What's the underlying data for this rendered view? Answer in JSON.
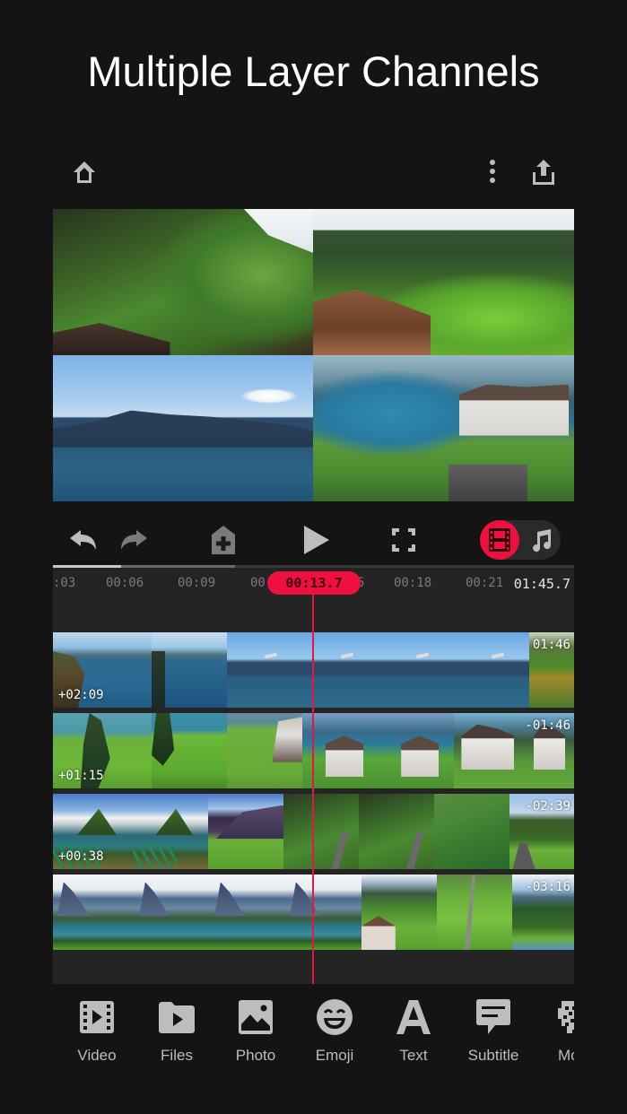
{
  "headline": "Multiple Layer Channels",
  "top_bar": {
    "home_icon": "home-icon",
    "more_icon": "more-vertical-icon",
    "export_icon": "share-upload-icon"
  },
  "preview": {
    "tiles": [
      {
        "name": "rail-hillside",
        "icon": "video-frame"
      },
      {
        "name": "alpine-valley",
        "icon": "video-frame"
      },
      {
        "name": "lake-seagull",
        "icon": "video-frame"
      },
      {
        "name": "lakeside-town",
        "icon": "video-frame"
      }
    ]
  },
  "controls": {
    "undo_icon": "undo-icon",
    "redo_icon": "redo-icon",
    "add_keyframe_icon": "add-keyframe-icon",
    "play_icon": "play-icon",
    "fullscreen_icon": "fullscreen-icon",
    "mode_video_icon": "film-icon",
    "mode_audio_icon": "music-note-icon",
    "active_mode": "video"
  },
  "colors": {
    "accent": "#f0103f",
    "background": "#141414",
    "timeline_bg": "#242424",
    "icon_gray": "#bdbdbd"
  },
  "timeline": {
    "progress": {
      "played_fraction": 0.13,
      "buffered_fraction": 0.35
    },
    "ticks": [
      ":03",
      "00:06",
      "00:09",
      "00",
      "5",
      "00:18",
      "00:21"
    ],
    "current_time": "00:13.7",
    "total_time": "01:45.7",
    "tracks": [
      {
        "offset_label": "+02:09",
        "end_label": "01:46"
      },
      {
        "offset_label": "+01:15",
        "end_label": "-01:46"
      },
      {
        "offset_label": "+00:38",
        "end_label": "-02:39"
      },
      {
        "offset_label": "",
        "end_label": "-03:16"
      }
    ]
  },
  "toolbar": {
    "items": [
      {
        "label": "Video",
        "icon": "video-clip-icon"
      },
      {
        "label": "Files",
        "icon": "folder-play-icon"
      },
      {
        "label": "Photo",
        "icon": "photo-icon"
      },
      {
        "label": "Emoji",
        "icon": "emoji-icon"
      },
      {
        "label": "Text",
        "icon": "text-icon"
      },
      {
        "label": "Subtitle",
        "icon": "subtitle-icon"
      },
      {
        "label": "Mos",
        "icon": "mosaic-icon"
      }
    ]
  }
}
